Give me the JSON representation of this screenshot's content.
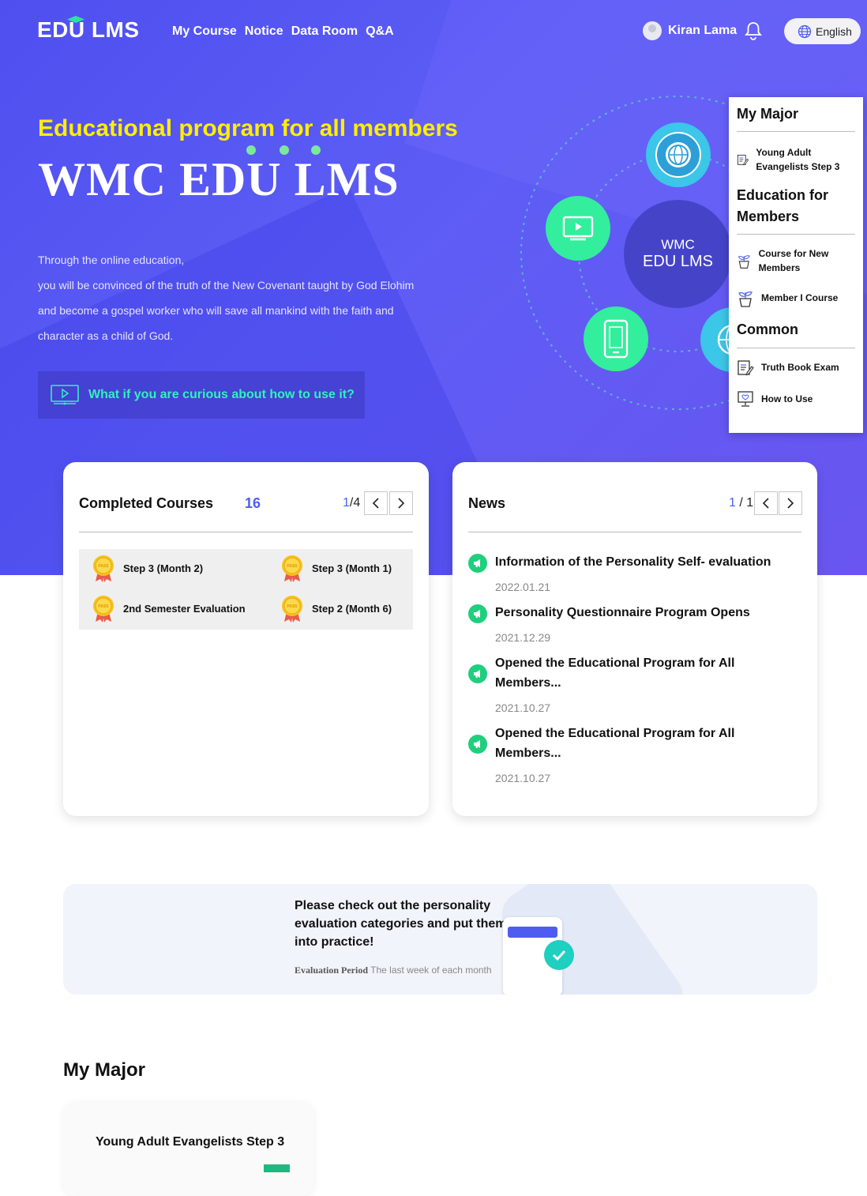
{
  "header": {
    "logo": "EDU LMS",
    "nav": [
      "My Course",
      "Notice",
      "Data Room",
      "Q&A"
    ],
    "user_name": "Kiran Lama",
    "language": "English"
  },
  "hero": {
    "tagline": "Educational program for all members",
    "title": "WMC EDU LMS",
    "description": [
      "Through the online education,",
      "you will be convinced of the truth of the New Covenant taught by God Elohim",
      "and become a gospel worker who will save all mankind with the faith and",
      "character as a child of God."
    ],
    "cta": "What if you are curious about how to use it?",
    "center_line1": "WMC",
    "center_line2": "EDU LMS"
  },
  "sidebar": {
    "sections": [
      {
        "title": "My Major",
        "items": [
          "Young Adult Evangelists Step 3"
        ]
      },
      {
        "title": "Education for Members",
        "items": [
          "Course for New Members",
          "Member I Course"
        ]
      },
      {
        "title": "Common",
        "items": [
          "Truth Book Exam",
          "How to Use"
        ]
      }
    ]
  },
  "completed": {
    "title": "Completed Courses",
    "count": "16",
    "page_current": "1",
    "page_total": "4",
    "items": [
      "Step 3 (Month 2)",
      "Step 3 (Month 1)",
      "2nd Semester Evaluation",
      "Step 2 (Month 6)"
    ]
  },
  "news": {
    "title": "News",
    "page_current": "1",
    "page_total": "1",
    "items": [
      {
        "title": "Information of the Personality Self- evaluation",
        "date": "2022.01.21"
      },
      {
        "title": "Personality Questionnaire Program Opens",
        "date": "2021.12.29"
      },
      {
        "title": "Opened the Educational Program for All Members...",
        "date": "2021.10.27"
      },
      {
        "title": "Opened the Educational Program for All Members...",
        "date": "2021.10.27"
      }
    ]
  },
  "banner": {
    "text": "Please check out the personality evaluation categories and put them into practice!",
    "period_label": "Evaluation Period",
    "period_value": "The last week of each month"
  },
  "my_major": {
    "title": "My Major",
    "course": "Young Adult Evangelists Step 3"
  },
  "colors": {
    "hero": "#5858f2",
    "accent_yellow": "#ffee00",
    "accent_green": "#1fcf7e",
    "accent_blue": "#4e5df0"
  }
}
